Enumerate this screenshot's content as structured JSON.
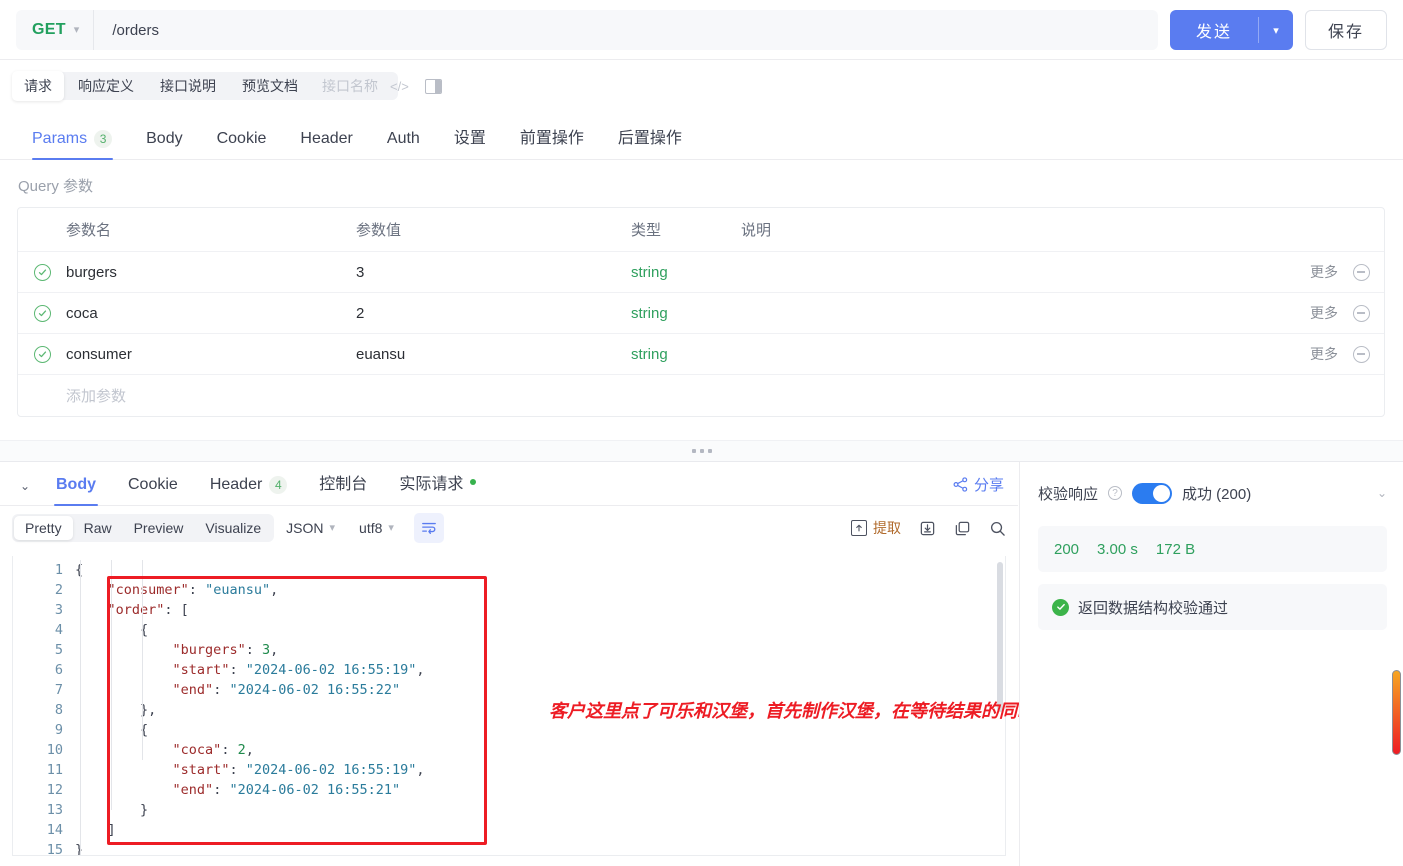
{
  "urlbar": {
    "method": "GET",
    "path": "/orders",
    "send_label": "发送",
    "save_label": "保存",
    "method_caret_icon": "chevron-down-icon",
    "send_caret_icon": "chevron-down-icon"
  },
  "subtabs": {
    "items": [
      {
        "label": "请求",
        "active": true
      },
      {
        "label": "响应定义",
        "active": false
      },
      {
        "label": "接口说明",
        "active": false
      },
      {
        "label": "预览文档",
        "active": false
      }
    ],
    "ghost_label": "接口名称",
    "code_icon": "code-brackets-icon",
    "panel_icon": "layout-panel-icon"
  },
  "maintabs": {
    "items": [
      {
        "label": "Params",
        "badge": "3",
        "active": true
      },
      {
        "label": "Body",
        "badge": "",
        "active": false
      },
      {
        "label": "Cookie",
        "badge": "",
        "active": false
      },
      {
        "label": "Header",
        "badge": "",
        "active": false
      },
      {
        "label": "Auth",
        "badge": "",
        "active": false
      },
      {
        "label": "设置",
        "badge": "",
        "active": false
      },
      {
        "label": "前置操作",
        "badge": "",
        "active": false
      },
      {
        "label": "后置操作",
        "badge": "",
        "active": false
      }
    ]
  },
  "params": {
    "section_label": "Query 参数",
    "columns": [
      "参数名",
      "参数值",
      "类型",
      "说明"
    ],
    "rows": [
      {
        "name": "burgers",
        "value": "3",
        "type": "string",
        "desc": "",
        "more": "更多"
      },
      {
        "name": "coca",
        "value": "2",
        "type": "string",
        "desc": "",
        "more": "更多"
      },
      {
        "name": "consumer",
        "value": "euansu",
        "type": "string",
        "desc": "",
        "more": "更多"
      }
    ],
    "add_row_label": "添加参数",
    "check_icon": "check-circle-icon",
    "remove_icon": "minus-circle-icon"
  },
  "splitter": {
    "handle_icon": "drag-handle-dots-icon"
  },
  "response": {
    "collapse_icon": "chevron-down-icon",
    "tabs": [
      {
        "label": "Body",
        "badge": "",
        "active": true,
        "dot": false
      },
      {
        "label": "Cookie",
        "badge": "",
        "active": false,
        "dot": false
      },
      {
        "label": "Header",
        "badge": "4",
        "active": false,
        "dot": false
      },
      {
        "label": "控制台",
        "badge": "",
        "active": false,
        "dot": false
      },
      {
        "label": "实际请求",
        "badge": "",
        "active": false,
        "dot": true
      }
    ],
    "share_label": "分享",
    "share_icon": "share-icon",
    "format": {
      "segments": [
        {
          "label": "Pretty",
          "active": true
        },
        {
          "label": "Raw",
          "active": false
        },
        {
          "label": "Preview",
          "active": false
        },
        {
          "label": "Visualize",
          "active": false
        }
      ],
      "lang": "JSON",
      "encoding": "utf8",
      "wrap_icon": "word-wrap-icon",
      "extract_label": "提取",
      "extract_icon": "extract-icon",
      "download_icon": "download-icon",
      "copy_icon": "copy-icon",
      "search_icon": "search-icon"
    },
    "code": {
      "language": "json",
      "lines": [
        {
          "num": "1",
          "indent": 0,
          "tokens": [
            {
              "t": "p",
              "v": "{"
            }
          ]
        },
        {
          "num": "2",
          "indent": 1,
          "tokens": [
            {
              "t": "k",
              "v": "\"consumer\""
            },
            {
              "t": "p",
              "v": ": "
            },
            {
              "t": "s",
              "v": "\"euansu\""
            },
            {
              "t": "p",
              "v": ","
            }
          ]
        },
        {
          "num": "3",
          "indent": 1,
          "tokens": [
            {
              "t": "k",
              "v": "\"order\""
            },
            {
              "t": "p",
              "v": ": ["
            }
          ]
        },
        {
          "num": "4",
          "indent": 2,
          "tokens": [
            {
              "t": "p",
              "v": "{"
            }
          ]
        },
        {
          "num": "5",
          "indent": 3,
          "tokens": [
            {
              "t": "k",
              "v": "\"burgers\""
            },
            {
              "t": "p",
              "v": ": "
            },
            {
              "t": "n",
              "v": "3"
            },
            {
              "t": "p",
              "v": ","
            }
          ]
        },
        {
          "num": "6",
          "indent": 3,
          "tokens": [
            {
              "t": "k",
              "v": "\"start\""
            },
            {
              "t": "p",
              "v": ": "
            },
            {
              "t": "s",
              "v": "\"2024-06-02 16:55:19\""
            },
            {
              "t": "p",
              "v": ","
            }
          ]
        },
        {
          "num": "7",
          "indent": 3,
          "tokens": [
            {
              "t": "k",
              "v": "\"end\""
            },
            {
              "t": "p",
              "v": ": "
            },
            {
              "t": "s",
              "v": "\"2024-06-02 16:55:22\""
            }
          ]
        },
        {
          "num": "8",
          "indent": 2,
          "tokens": [
            {
              "t": "p",
              "v": "},"
            }
          ]
        },
        {
          "num": "9",
          "indent": 2,
          "tokens": [
            {
              "t": "p",
              "v": "{"
            }
          ]
        },
        {
          "num": "10",
          "indent": 3,
          "tokens": [
            {
              "t": "k",
              "v": "\"coca\""
            },
            {
              "t": "p",
              "v": ": "
            },
            {
              "t": "n",
              "v": "2"
            },
            {
              "t": "p",
              "v": ","
            }
          ]
        },
        {
          "num": "11",
          "indent": 3,
          "tokens": [
            {
              "t": "k",
              "v": "\"start\""
            },
            {
              "t": "p",
              "v": ": "
            },
            {
              "t": "s",
              "v": "\"2024-06-02 16:55:19\""
            },
            {
              "t": "p",
              "v": ","
            }
          ]
        },
        {
          "num": "12",
          "indent": 3,
          "tokens": [
            {
              "t": "k",
              "v": "\"end\""
            },
            {
              "t": "p",
              "v": ": "
            },
            {
              "t": "s",
              "v": "\"2024-06-02 16:55:21\""
            }
          ]
        },
        {
          "num": "13",
          "indent": 2,
          "tokens": [
            {
              "t": "p",
              "v": "}"
            }
          ]
        },
        {
          "num": "14",
          "indent": 1,
          "tokens": [
            {
              "t": "p",
              "v": "]"
            }
          ]
        },
        {
          "num": "15",
          "indent": 0,
          "tokens": [
            {
              "t": "p",
              "v": "}"
            }
          ]
        }
      ]
    },
    "annotation": "客户这里点了可乐和汉堡，首先制作汉堡，在等待结果的同时开始制作可乐",
    "annotation_color": "#ed1c24",
    "highlight_box_color": "#ed1c24"
  },
  "verify": {
    "label": "校验响应",
    "help_icon": "question-circle-icon",
    "toggle_on": true,
    "toggle_color": "#2b7cf0",
    "status": "成功 (200)",
    "caret_icon": "chevron-down-icon",
    "stats": {
      "code": "200",
      "time": "3.00 s",
      "size": "172 B",
      "color": "#2fa05e"
    },
    "pass_text": "返回数据结构校验通过",
    "pass_icon": "check-circle-filled-icon"
  },
  "scrollbar": {
    "name": "page-scrollbar"
  }
}
